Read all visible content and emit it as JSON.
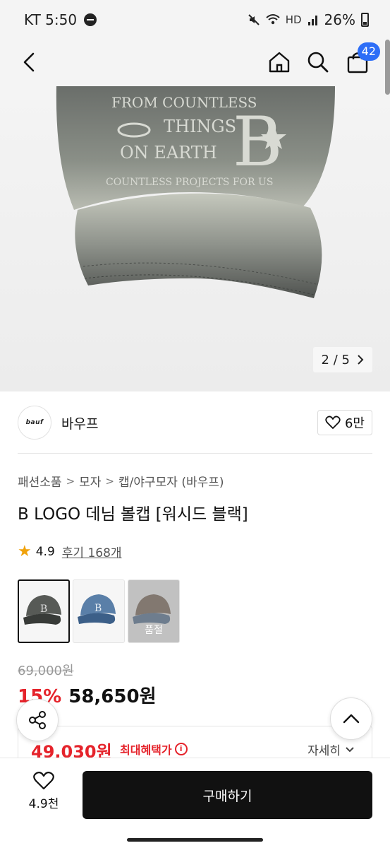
{
  "status": {
    "carrier_time": "KT 5:50",
    "hd": "HD",
    "battery": "26%"
  },
  "nav": {
    "cart_count": "42"
  },
  "hero": {
    "image_text": [
      "FROM COUNTLESS",
      "THINGS",
      "ON EARTH",
      "COUNTLESS PROJECTS FOR US"
    ],
    "page_current": "2",
    "page_separator": "/",
    "page_total": "5"
  },
  "brand": {
    "logo_text": "bauf",
    "name": "바우프",
    "like_count": "6만"
  },
  "breadcrumb": [
    "패션소품",
    "모자",
    "캡/야구모자 (바우프)"
  ],
  "product": {
    "title": "B LOGO 데님 볼캡 [워시드 블랙]",
    "rating": "4.9",
    "review_label": "후기 168개"
  },
  "options": [
    {
      "color": "washed-black",
      "selected": true
    },
    {
      "color": "blue-denim",
      "selected": false
    },
    {
      "color": "brown-denim",
      "selected": false,
      "soldout_label": "품절"
    }
  ],
  "price": {
    "original": "69,000원",
    "discount_rate": "15%",
    "sale": "58,650원"
  },
  "benefit": {
    "price": "49,030원",
    "label": "최대혜택가",
    "detail_label": "자세히"
  },
  "bottom": {
    "wish_count": "4.9천",
    "buy_label": "구매하기"
  },
  "colors": {
    "accent_red": "#e5232b",
    "badge_blue": "#2d6ef7",
    "star": "#f0a20b"
  }
}
